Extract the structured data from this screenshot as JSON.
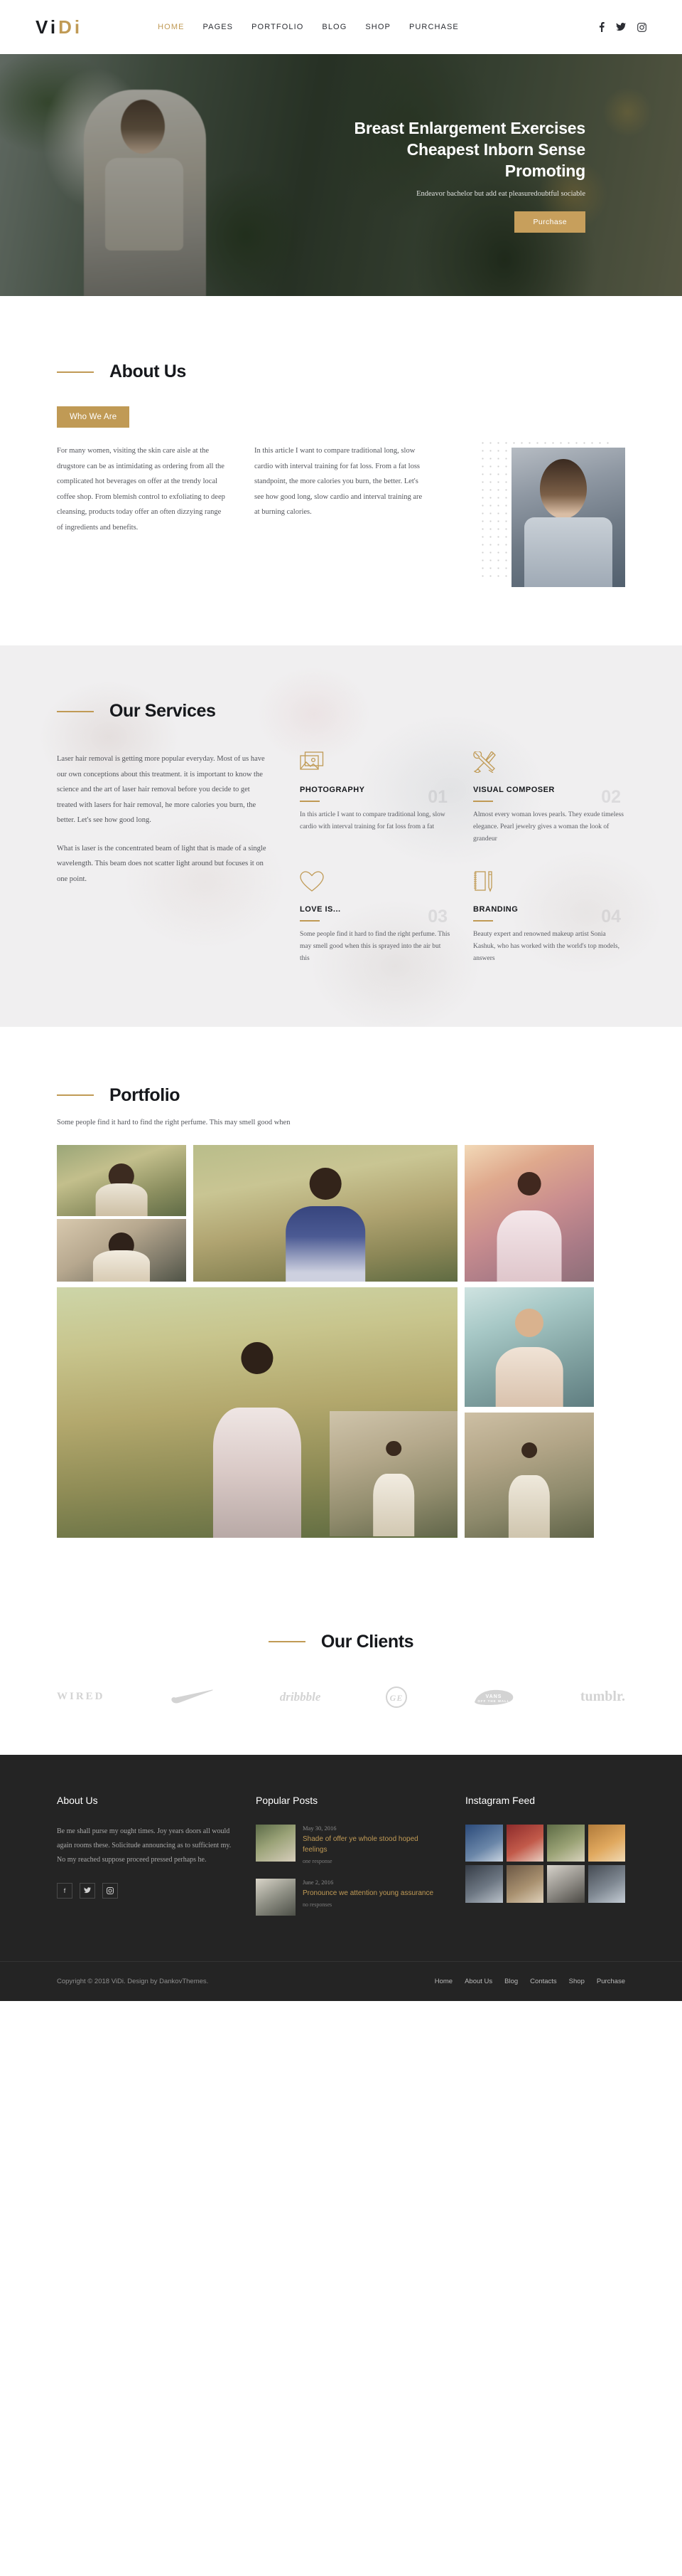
{
  "header": {
    "logo": {
      "v": "V",
      "i1": "i",
      "d": "D",
      "i2": "i"
    },
    "nav": [
      {
        "label": "HOME",
        "active": true
      },
      {
        "label": "PAGES",
        "active": false
      },
      {
        "label": "PORTFOLIO",
        "active": false
      },
      {
        "label": "BLOG",
        "active": false
      },
      {
        "label": "SHOP",
        "active": false
      },
      {
        "label": "PURCHASE",
        "active": false
      }
    ],
    "social": [
      "facebook-icon",
      "twitter-icon",
      "instagram-icon"
    ]
  },
  "hero": {
    "title": "Breast Enlargement Exercises Cheapest Inborn Sense Promoting",
    "subtitle": "Endeavor bachelor but add eat pleasuredoubtful sociable",
    "button": "Purchase"
  },
  "about": {
    "heading": "About Us",
    "badge": "Who We Are",
    "col1": "For many women, visiting the skin care aisle at the drugstore can be as intimidating as ordering from all the complicated hot beverages on offer at the trendy local coffee shop. From blemish control to exfoliating to deep cleansing, products today offer an often dizzying range of ingredients and benefits.",
    "col2": "In this article I want to compare traditional long, slow cardio with interval training for fat loss. From a fat loss standpoint, the more calories you burn, the better. Let's see how good long, slow cardio and interval training are at burning calories."
  },
  "services": {
    "heading": "Our Services",
    "intro": "Laser hair removal is getting more popular everyday. Most of us have our own conceptions about this treatment. it is important to know the science and the art of laser hair removal before you decide to get treated with lasers for hair removal, he more calories you burn, the better. Let's see how good long.",
    "intro2": "What is laser is the concentrated beam of light that is made of a single wavelength. This beam does not scatter light around but focuses it on one point.",
    "cards": [
      {
        "num": "01",
        "icon": "image-icon",
        "title": "PHOTOGRAPHY",
        "text": "In this article I want to compare traditional long, slow cardio with interval training for fat loss from a fat"
      },
      {
        "num": "02",
        "icon": "tools-icon",
        "title": "VISUAL COMPOSER",
        "text": "Almost every woman loves pearls. They exude timeless elegance. Pearl jewelry gives a woman the look of grandeur"
      },
      {
        "num": "03",
        "icon": "heart-icon",
        "title": "LOVE IS...",
        "text": "Some people find it hard to find the right perfume. This may smell good when this is sprayed into the air but this"
      },
      {
        "num": "04",
        "icon": "notebook-pencil-icon",
        "title": "BRANDING",
        "text": "Beauty expert and renowned makeup artist Sonia Kashuk, who has worked with the world's top models, answers"
      }
    ]
  },
  "portfolio": {
    "heading": "Portfolio",
    "subtitle": "Some people find it hard to find the right perfume. This may smell good when",
    "tiles": [
      {
        "name": "portfolio-tile-1"
      },
      {
        "name": "portfolio-tile-2"
      },
      {
        "name": "portfolio-tile-3"
      },
      {
        "name": "portfolio-tile-4"
      },
      {
        "name": "portfolio-tile-5"
      },
      {
        "name": "portfolio-tile-6"
      },
      {
        "name": "portfolio-tile-7"
      },
      {
        "name": "portfolio-tile-8"
      },
      {
        "name": "portfolio-tile-9"
      }
    ]
  },
  "clients": {
    "heading": "Our Clients",
    "logos": [
      "WIRED",
      "NIKE",
      "dribbble",
      "GE",
      "VANS",
      "tumblr."
    ]
  },
  "footer": {
    "about": {
      "title": "About Us",
      "text": "Be me shall purse my ought times. Joy years doors all would again rooms these. Solicitude announcing as to sufficient my. No my reached suppose proceed pressed perhaps he."
    },
    "posts": {
      "title": "Popular Posts",
      "items": [
        {
          "date": "May 30, 2016",
          "title": "Shade of offer ye whole stood hoped feelings",
          "meta": "one response"
        },
        {
          "date": "June 2, 2016",
          "title": "Pronounce we attention young assurance",
          "meta": "no responses"
        }
      ]
    },
    "instagram": {
      "title": "Instagram Feed"
    },
    "copyright": "Copyright © 2018 ViDi. Design by DankovThemes.",
    "nav": [
      "Home",
      "About Us",
      "Blog",
      "Contacts",
      "Shop",
      "Purchase"
    ]
  },
  "colors": {
    "accent": "#c09a55",
    "dark": "#242424",
    "text": "#23252a"
  }
}
